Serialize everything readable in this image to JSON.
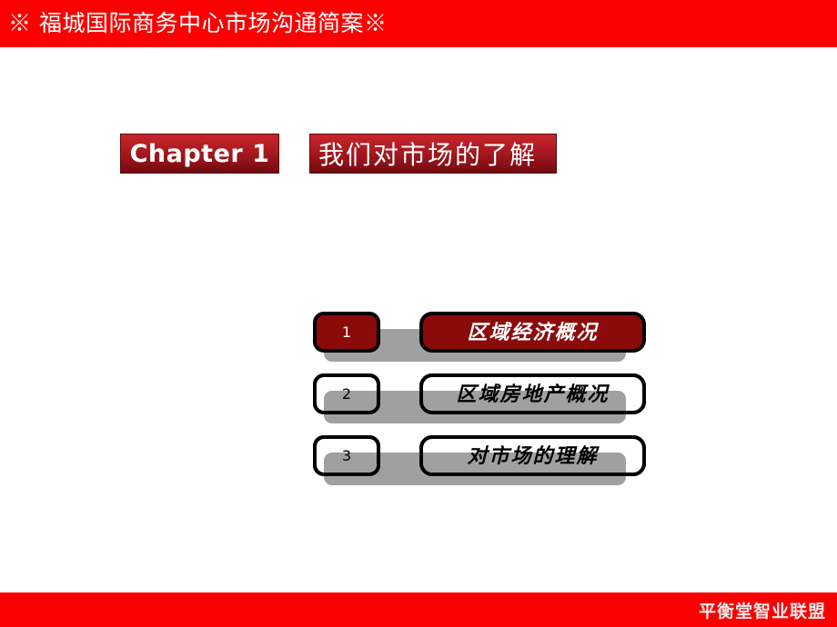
{
  "slide": {
    "header": {
      "title": "※ 福城国际商务中心市场沟通简案※",
      "background_color": "#fb0000",
      "text_color": "#ffffff"
    },
    "chapter": {
      "badge_label": "Chapter 1",
      "title_label": "我们对市场的了解",
      "badge_color": "#ae1b22",
      "title_box_color": "#ae1b22"
    },
    "agenda": {
      "items": [
        {
          "number": "1",
          "label": "区域经济概况",
          "state": "active",
          "box_color": "#8b0b0b",
          "text_color": "#ffffff"
        },
        {
          "number": "2",
          "label": "区域房地产概况",
          "state": "inactive",
          "box_color": "#ffffff",
          "text_color": "#000000"
        },
        {
          "number": "3",
          "label": "对市场的理解",
          "state": "inactive",
          "box_color": "#ffffff",
          "text_color": "#000000"
        }
      ],
      "shadow_color": "#a0a0a0"
    },
    "footer": {
      "text": "平衡堂智业联盟",
      "background_color": "#fb0000",
      "text_color": "#e8e8e8"
    }
  }
}
